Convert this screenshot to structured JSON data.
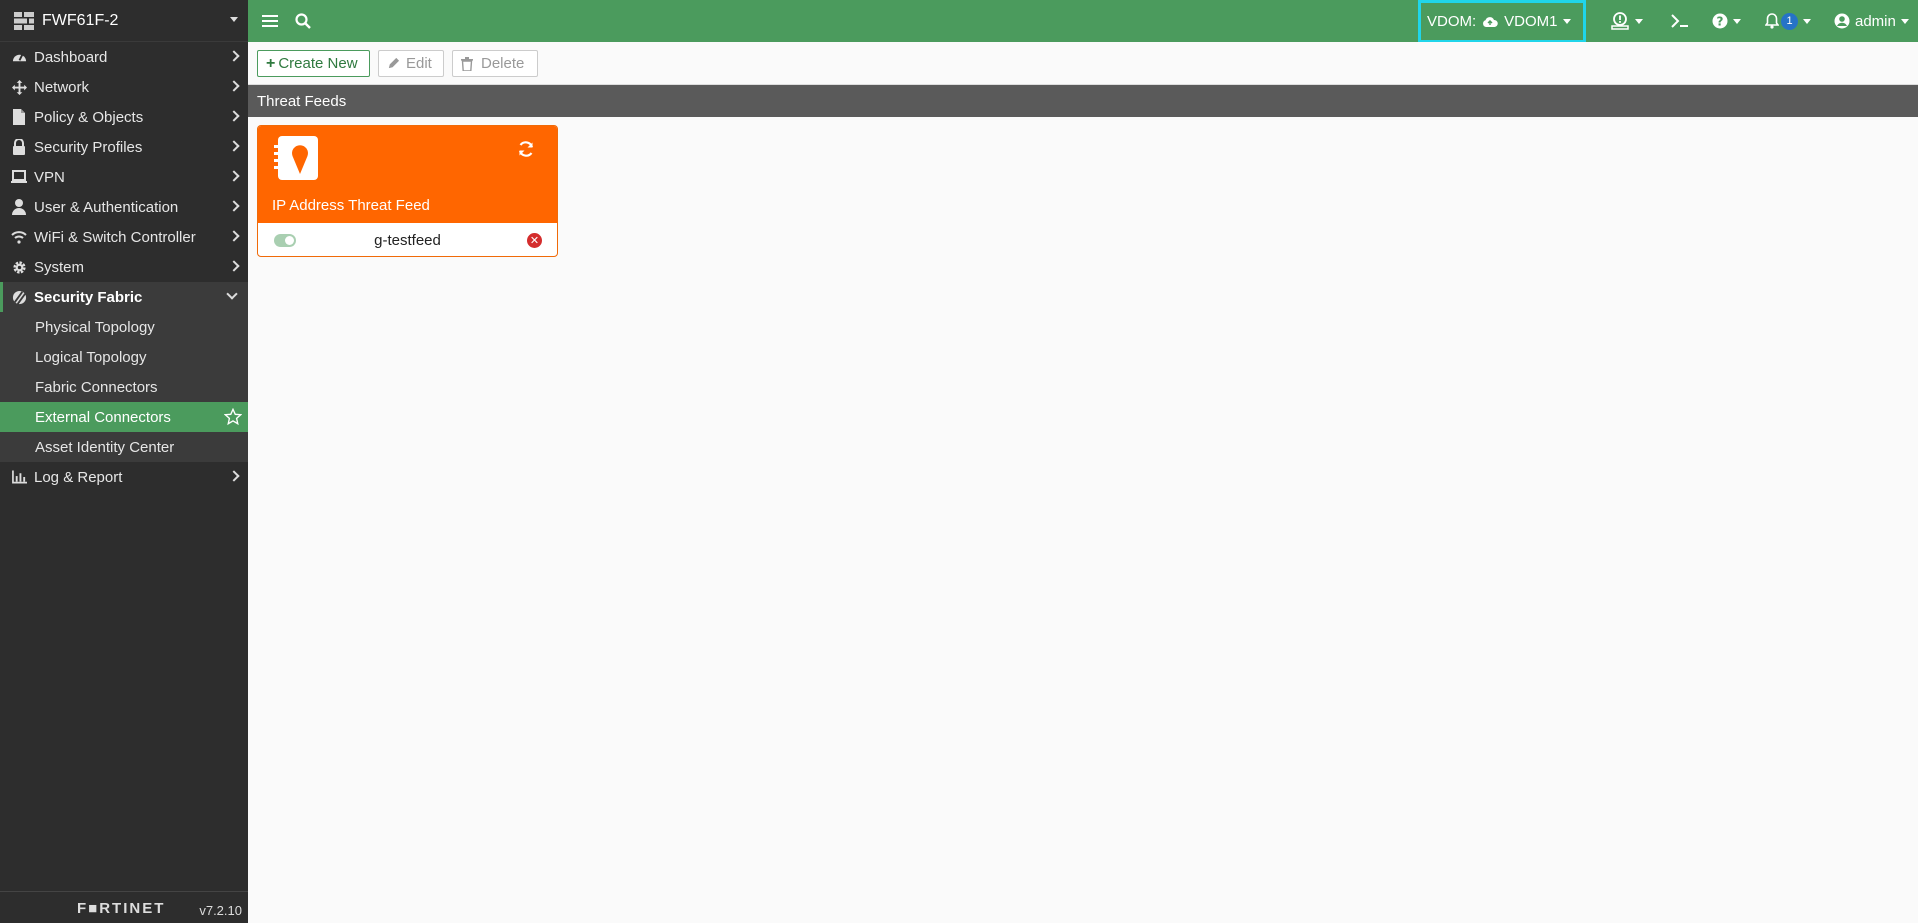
{
  "device": {
    "name": "FWF61F-2"
  },
  "nav": {
    "dashboard": "Dashboard",
    "network": "Network",
    "policy": "Policy & Objects",
    "security_profiles": "Security Profiles",
    "vpn": "VPN",
    "user_auth": "User & Authentication",
    "wifi": "WiFi & Switch Controller",
    "system": "System",
    "security_fabric": "Security Fabric",
    "sub": {
      "physical": "Physical Topology",
      "logical": "Logical Topology",
      "fabric_connectors": "Fabric Connectors",
      "external_connectors": "External Connectors",
      "asset_identity": "Asset Identity Center"
    },
    "log_report": "Log & Report"
  },
  "footer": {
    "logo": "F■RTINET",
    "version": "v7.2.10"
  },
  "topbar": {
    "vdom_label": "VDOM:",
    "vdom_value": "VDOM1",
    "notification_count": "1",
    "user": "admin"
  },
  "toolbar": {
    "create": "Create New",
    "edit": "Edit",
    "delete": "Delete"
  },
  "section": {
    "title": "Threat Feeds"
  },
  "card": {
    "title": "IP Address Threat Feed",
    "name": "g-testfeed",
    "enabled": true
  },
  "colors": {
    "accent": "#4b9b5d",
    "card": "#ff6600",
    "highlight": "#20d5ea"
  }
}
